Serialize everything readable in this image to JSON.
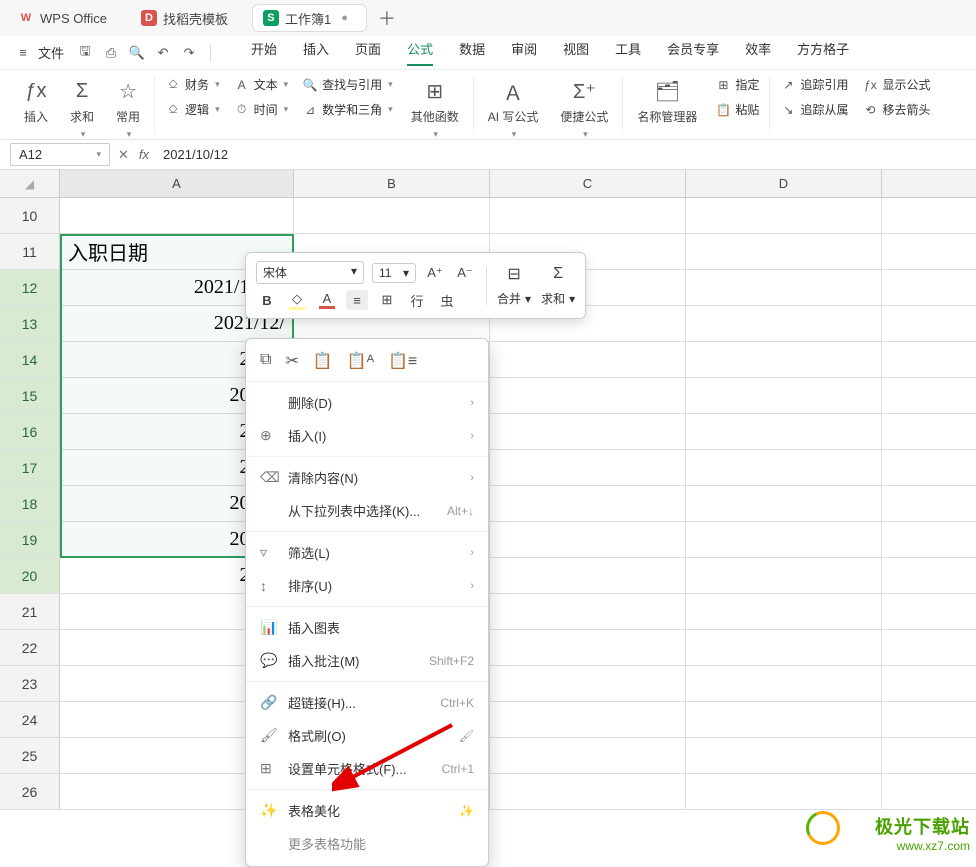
{
  "tabs": {
    "wps": "WPS Office",
    "shell": "找稻壳模板",
    "sheet": "工作簿1"
  },
  "menu": {
    "file": "文件",
    "items": [
      "开始",
      "插入",
      "页面",
      "公式",
      "数据",
      "审阅",
      "视图",
      "工具",
      "会员专享",
      "效率",
      "方方格子"
    ],
    "active_index": 3
  },
  "ribbon": {
    "insert_fn": "插入",
    "sum": "求和",
    "common": "常用",
    "finance": "财务",
    "text": "文本",
    "lookup": "查找与引用",
    "logic": "逻辑",
    "time": "时间",
    "math": "数学和三角",
    "other": "其他函数",
    "ai": "AI 写公式",
    "quick": "便捷公式",
    "name": "名称管理器",
    "define": "指定",
    "paste": "粘贴",
    "trace_ref": "追踪引用",
    "trace_dep": "追踪从属",
    "show_fx": "显示公式",
    "remove_arrow": "移去箭头"
  },
  "fx": {
    "symbol": "fx",
    "name": "A12",
    "value": "2021/10/12"
  },
  "cols": [
    "A",
    "B",
    "C",
    "D"
  ],
  "rows": {
    "10": "",
    "11": "入职日期",
    "12": "2021/10/12",
    "13": "2021/12/",
    "14": "2022/",
    "15": "2022/4",
    "16": "2020/",
    "17": "2022/",
    "18": "2020/1",
    "19": "2022/1",
    "20": "2023/"
  },
  "mini": {
    "font": "宋体",
    "size": "11",
    "bold": "B",
    "merge": "合并",
    "sum": "求和"
  },
  "ctx": {
    "delete": "删除(D)",
    "insert": "插入(I)",
    "clear": "清除内容(N)",
    "dropdown": "从下拉列表中选择(K)...",
    "dropdown_hint": "Alt+↓",
    "filter": "筛选(L)",
    "sort": "排序(U)",
    "chart": "插入图表",
    "comment": "插入批注(M)",
    "comment_hint": "Shift+F2",
    "hyperlink": "超链接(H)...",
    "hyperlink_hint": "Ctrl+K",
    "fmtpaint": "格式刷(O)",
    "format": "设置单元格格式(F)...",
    "format_hint": "Ctrl+1",
    "beautify": "表格美化",
    "more": "更多表格功能"
  },
  "watermark": {
    "line1": "极光下载站",
    "line2": "www.xz7.com"
  }
}
